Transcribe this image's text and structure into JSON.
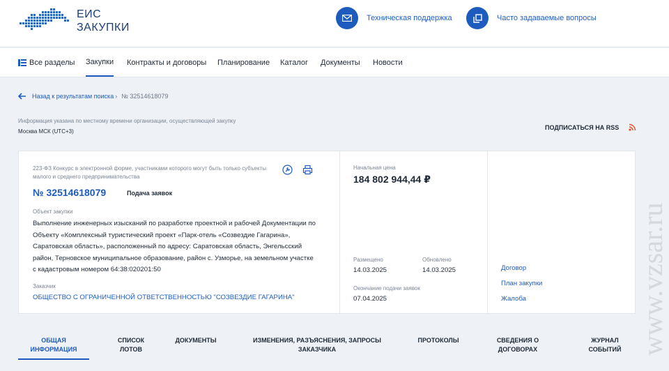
{
  "header": {
    "logo_line1": "ЕИС",
    "logo_line2": "ЗАКУПКИ",
    "support": "Техническая поддержка",
    "faq": "Часто задаваемые вопросы"
  },
  "nav": {
    "all_sections": "Все разделы",
    "items": [
      "Закупки",
      "Контракты и договоры",
      "Планирование",
      "Каталог",
      "Документы",
      "Новости"
    ]
  },
  "breadcrumb": {
    "back": "Назад к результатам поиска",
    "sep": "›",
    "current": "№ 32514618079"
  },
  "info_note": "Информация указана по местному времени организации, осуществляющей закупку",
  "timezone": "Москва МСК (UTC+3)",
  "rss": "ПОДПИСАТЬСЯ НА RSS",
  "card": {
    "law_type": "223-ФЗ Конкурс в электронной форме, участниками которого могут быть только субъекты малого и среднего предпринимательства",
    "reg_number": "№ 32514618079",
    "status": "Подача заявок",
    "object_label": "Объект закупки",
    "object_text": "Выполнение инженерных изысканий по разработке проектной и рабочей Документации по Объекту «Комплексный туристический проект «Парк-отель «Созвездие Гагарина», Саратовская область», расположенный по адресу: Саратовская область, Энгельсский район, Терновское муниципальное образование, район с. Узморье, на земельном участке с кадастровым номером 64:38:020201:50",
    "customer_label": "Заказчик",
    "customer": "ОБЩЕСТВО С ОГРАНИЧЕННОЙ ОТВЕТСТВЕННОСТЬЮ \"СОЗВЕЗДИЕ ГАГАРИНА\"",
    "price_label": "Начальная цена",
    "price": "184 802 944,44 ₽",
    "placed_label": "Размещено",
    "placed": "14.03.2025",
    "updated_label": "Обновлено",
    "updated": "14.03.2025",
    "deadline_label": "Окончание подачи заявок",
    "deadline": "07.04.2025",
    "links": [
      "Договор",
      "План закупки",
      "Жалоба"
    ]
  },
  "tabs": [
    {
      "line1": "ОБЩАЯ",
      "line2": "ИНФОРМАЦИЯ"
    },
    {
      "line1": "СПИСОК",
      "line2": "ЛОТОВ"
    },
    {
      "line1": "ДОКУМЕНТЫ",
      "line2": ""
    },
    {
      "line1": "ИЗМЕНЕНИЯ, РАЗЪЯСНЕНИЯ, ЗАПРОСЫ",
      "line2": "ЗАКАЗЧИКА"
    },
    {
      "line1": "ПРОТОКОЛЫ",
      "line2": ""
    },
    {
      "line1": "СВЕДЕНИЯ О",
      "line2": "ДОГОВОРАХ"
    },
    {
      "line1": "ЖУРНАЛ",
      "line2": "СОБЫТИЙ"
    }
  ],
  "watermark": "www.vzsar.ru",
  "colors": {
    "accent": "#1d5bbf",
    "rss": "#e8542a"
  }
}
